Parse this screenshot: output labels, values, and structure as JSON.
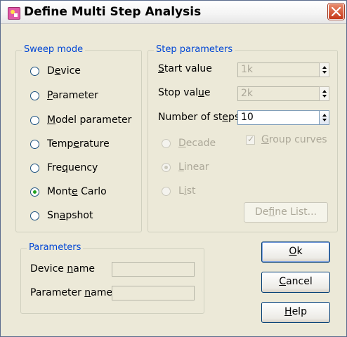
{
  "window": {
    "title": "Define Multi Step Analysis"
  },
  "sweep_mode": {
    "title": "Sweep mode",
    "options": [
      {
        "pre": "D",
        "key": "e",
        "post": "vice",
        "checked": false
      },
      {
        "pre": "",
        "key": "P",
        "post": "arameter",
        "checked": false
      },
      {
        "pre": "",
        "key": "M",
        "post": "odel parameter",
        "checked": false
      },
      {
        "pre": "Temp",
        "key": "e",
        "post": "rature",
        "checked": false
      },
      {
        "pre": "Fre",
        "key": "q",
        "post": "uency",
        "checked": false
      },
      {
        "pre": "Mont",
        "key": "e",
        "post": " Carlo",
        "checked": true
      },
      {
        "pre": "Sn",
        "key": "a",
        "post": "pshot",
        "checked": false
      }
    ]
  },
  "step_parameters": {
    "title": "Step parameters",
    "start": {
      "pre": "",
      "key": "S",
      "post": "tart value",
      "value": "1k"
    },
    "stop": {
      "pre": "Stop val",
      "key": "u",
      "post": "e",
      "value": "2k"
    },
    "steps": {
      "pre": "Number of st",
      "key": "e",
      "post": "ps",
      "value": "10"
    },
    "scale_options": [
      {
        "pre": "",
        "key": "D",
        "post": "ecade",
        "checked": false
      },
      {
        "pre": "",
        "key": "L",
        "post": "inear",
        "checked": true
      },
      {
        "pre": "L",
        "key": "i",
        "post": "st",
        "checked": false
      }
    ],
    "group_curves": {
      "pre": "",
      "key": "G",
      "post": "roup curves",
      "checked": true
    },
    "define_list": {
      "pre": "De",
      "key": "f",
      "post": "ine List..."
    }
  },
  "parameters": {
    "title": "Parameters",
    "device_name": {
      "pre": "Device ",
      "key": "n",
      "post": "ame",
      "value": ""
    },
    "parameter_name": {
      "pre": "Parameter ",
      "key": "n",
      "post": "ame",
      "value": ""
    }
  },
  "buttons": {
    "ok": {
      "pre": "",
      "key": "O",
      "post": "k"
    },
    "cancel": {
      "pre": "",
      "key": "C",
      "post": "ancel"
    },
    "help": {
      "pre": "",
      "key": "H",
      "post": "elp"
    }
  }
}
